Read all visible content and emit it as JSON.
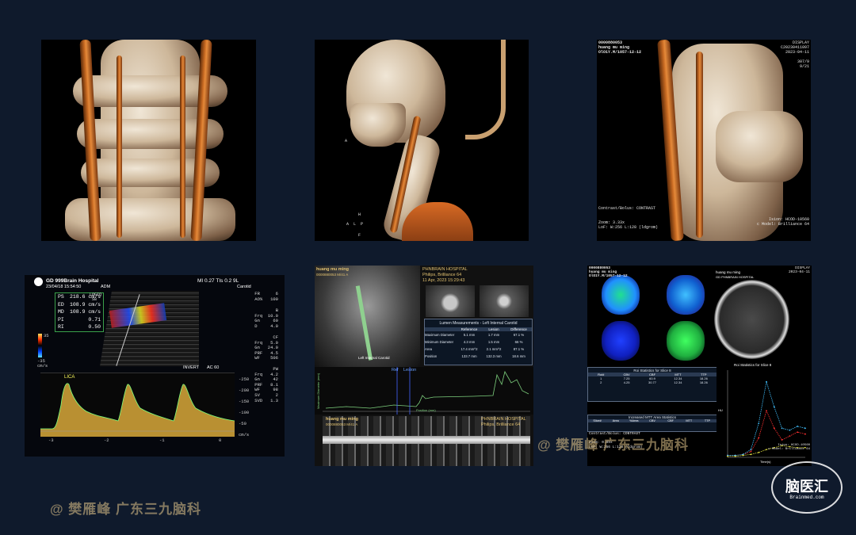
{
  "top_right_overlay": {
    "tl": "0000880053\nhuang mu ming\nOlO1Y.M/1057-12-12",
    "tr": "DISPLAY\nC20230411097\n2023-04-11\n\n307/9\n9/21",
    "bl": "Contrast/Bolus: CONTRAST\n\n\nZoom: 3.33x\nLoF: W:256 L:128 (ldgrom)",
    "br": "Ision: HCOD-10560\nc Model: Brilliance 64"
  },
  "top_middle_overlay": {
    "a": "A",
    "h": "H",
    "alp": "A  L  P",
    "f": "F"
  },
  "ultrasound": {
    "hospital": "GD 999Brain Hospital",
    "mi": "MI 0.27  TIs 0.2  9L",
    "datetime": "23/04/18  15:54:50",
    "user": "ADM",
    "preset": "Carotid",
    "logiq": "LOGIQ\n S8",
    "measurements": [
      {
        "label": "PS",
        "value": "218.6 cm/s"
      },
      {
        "label": "ED",
        "value": "108.9 cm/s"
      },
      {
        "label": "MD",
        "value": "108.9 cm/s"
      },
      {
        "label": "PI",
        "value": "0.71"
      },
      {
        "label": "RI",
        "value": "0.50"
      }
    ],
    "params_top": "FR      6\nAO%   100",
    "params_b": "B\nFrq  10.0\nGn     60\nD     4.0",
    "params_cf": "CF\nFrq   5.0\nGn   24.0\nPRF   4.5\nWF    506",
    "params_pw": "PW\nFrq   4.2\nGn     42\nPRF   8.1\nWF     98\nSV      2\nSVD   1.3",
    "colorbar_top": "35",
    "colorbar_bottom": "-35\ncm/s",
    "vessel_label": "LICA",
    "invert": "INVERT",
    "ac": "AC 60",
    "y_ticks": [
      "-250",
      "-200",
      "-150",
      "-100",
      "-50"
    ],
    "y_unit": "cm/s",
    "x_ticks": [
      "-3",
      "-2",
      "-1",
      "0"
    ]
  },
  "ct_left": {
    "patient": "huang mu ming",
    "id": "0000880053 M/41 A",
    "hospital": "PHNBRAIN HOSPITAL",
    "scanner": "Philips, Brilliance 64",
    "date": "11 Apr, 2023 15:29:43",
    "table_title": "Lumen Measurements - Left Internal Carotid",
    "table_header": [
      "",
      "Reference",
      "Lesion",
      "Difference"
    ],
    "table_rows": [
      [
        "Maximum Diameter",
        "5.1 mm",
        "1.7 mm",
        "67.1 %"
      ],
      [
        "Minimum Diameter",
        "4.3 mm",
        "1.5 mm",
        "66 %"
      ],
      [
        "Area",
        "17.4 mm^2",
        "2.1 mm^2",
        "87.1 %"
      ],
      [
        "Position",
        "133.7 mm",
        "132.3 mm",
        "18.6 mm"
      ]
    ],
    "curve_ylabel": "Maximum Diameter (mm)",
    "curve_xlabel": "Position (mm)",
    "ref_label": "Ref",
    "lesion_label": "Lesion",
    "vessel_label": "Left Internal Carotid",
    "patient2": "huang mu ming",
    "id2": "0000880053 M/41 A",
    "hospital2": "PHNBRAIN HOSPITAL",
    "scanner2": "Philips, Brilliance 64"
  },
  "ct_right": {
    "tl": "0000880053\nhuang mu ming\nOlO1Y.M/1057-12-12",
    "display": "DISPLAY\n2023-04-11",
    "patient": "huang mu ming",
    "hospital": "GD PHNBRAIN HOSPITAL",
    "roi_title": "Roi Statistics for Slice 8",
    "roi_header": [
      "Roi#",
      "CBV",
      "CBF",
      "MTT",
      "TTP"
    ],
    "roi_rows": [
      [
        "1",
        "7.25",
        "60.9",
        "12.34",
        "18.26"
      ],
      [
        "2",
        "4.25",
        "30.77",
        "12.34",
        "18.26"
      ]
    ],
    "mtt_title": "Increased MTT Area Statistics",
    "mtt_header": [
      "Slice#",
      "Area",
      "%Area",
      "CBV",
      "CBF",
      "MTT",
      "TTP"
    ],
    "bottom_text": "Contrast/Bolus: CONTRAST\n\nZoom: 0.89x\nLoF: W:256 L:128 (ldgrom)",
    "chart_title": "Roi Statistics for Slice 8",
    "chart_xlabel": "Time(s)",
    "chart_ylabel": "HU",
    "br": "Ision: HCOD-10560\nc Model: Brilliance 64"
  },
  "chart_data": {
    "type": "line",
    "title": "Roi Statistics for Slice 8",
    "xlabel": "Time(s)",
    "ylabel": "HU",
    "x": [
      0,
      5,
      10,
      15,
      20,
      25,
      30,
      35,
      40,
      45,
      50
    ],
    "series": [
      {
        "values": [
          2,
          2,
          3,
          6,
          20,
          48,
          30,
          18,
          22,
          26,
          24
        ],
        "color": "#ff3030"
      },
      {
        "values": [
          2,
          2,
          3,
          8,
          35,
          78,
          52,
          30,
          28,
          32,
          30
        ],
        "color": "#40c0ff"
      },
      {
        "values": [
          1,
          1,
          2,
          3,
          5,
          8,
          10,
          12,
          11,
          10,
          10
        ],
        "color": "#e0e040"
      }
    ],
    "ylim": [
      0,
      90
    ],
    "xlim": [
      0,
      50
    ]
  },
  "watermarks": {
    "middle": "@ 樊雁峰 广东三九脑科",
    "bottom": "@ 樊雁峰 广东三九脑科"
  },
  "logo": {
    "main": "脑医汇",
    "sub": "Brainmed.com"
  }
}
